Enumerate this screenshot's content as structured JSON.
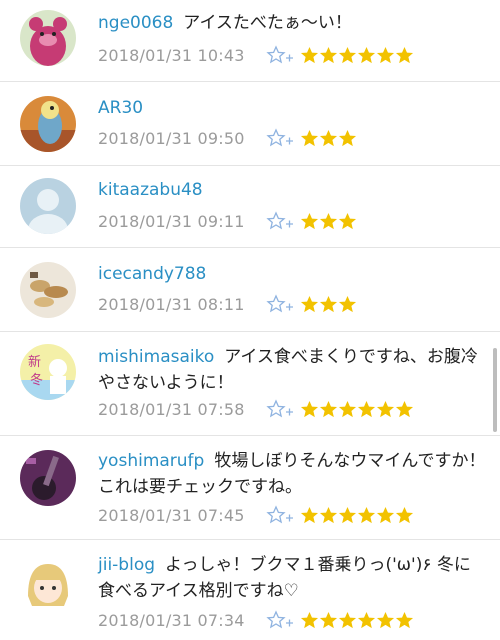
{
  "accent": {
    "username": "#2a8fc4",
    "star": "#f2c200",
    "fav_icon": "#8fb3e0"
  },
  "comments": [
    {
      "user": "nge0068",
      "text": "アイスたべたぁ〜い！",
      "date": "2018/01/31 10:43",
      "stars": 6,
      "avatar": "toy-bear-avatar"
    },
    {
      "user": "AR30",
      "text": "",
      "date": "2018/01/31 09:50",
      "stars": 3,
      "avatar": "parakeet-avatar"
    },
    {
      "user": "kitaazabu48",
      "text": "",
      "date": "2018/01/31 09:11",
      "stars": 3,
      "avatar": "default-person-avatar"
    },
    {
      "user": "icecandy788",
      "text": "",
      "date": "2018/01/31 08:11",
      "stars": 3,
      "avatar": "food-photo-avatar"
    },
    {
      "user": "mishimasaiko",
      "text": "アイス食べまくりですね、お腹冷やさないように！",
      "date": "2018/01/31 07:58",
      "stars": 6,
      "avatar": "new-winter-illustration-avatar"
    },
    {
      "user": "yoshimarufp",
      "text": "牧場しぼりそんなウマイんですか！これは要チェックですね。",
      "date": "2018/01/31 07:45",
      "stars": 6,
      "avatar": "guitar-photo-avatar"
    },
    {
      "user": "jii-blog",
      "text": "よっしゃ！ブクマ１番乗りっ('ω')۶ 冬に食べるアイス格別ですね♡",
      "date": "2018/01/31 07:34",
      "stars": 6,
      "avatar": "anime-girl-avatar"
    }
  ]
}
